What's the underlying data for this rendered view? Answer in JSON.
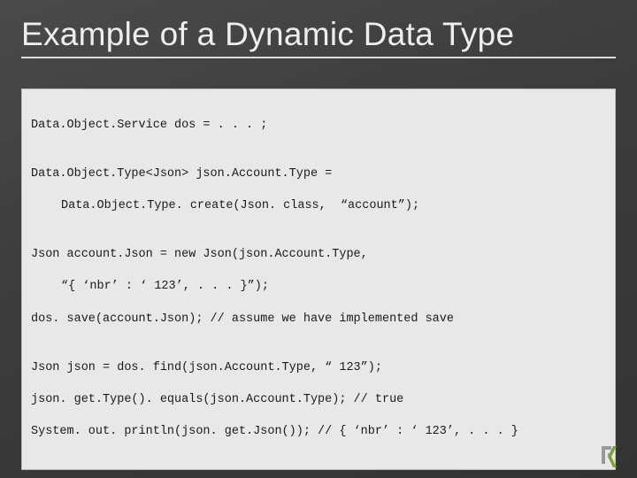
{
  "title": "Example of a Dynamic Data Type",
  "code": {
    "l1": "Data.Object.Service dos = . . . ;",
    "l2": "",
    "l3": "Data.Object.Type<Json> json.Account.Type =",
    "l4": "Data.Object.Type. create(Json. class,  “account”);",
    "l5": "",
    "l6": "Json account.Json = new Json(json.Account.Type,",
    "l7": "“{ ‘nbr’ : ‘ 123’, . . . }”);",
    "l8": "dos. save(account.Json); // assume we have implemented save",
    "l9": "",
    "l10": "Json json = dos. find(json.Account.Type, “ 123”);",
    "l11": "json. get.Type(). equals(json.Account.Type); // true",
    "l12": "System. out. println(json. get.Json()); // { ‘nbr’ : ‘ 123’, . . . }"
  },
  "logo_name": "brand-logo"
}
